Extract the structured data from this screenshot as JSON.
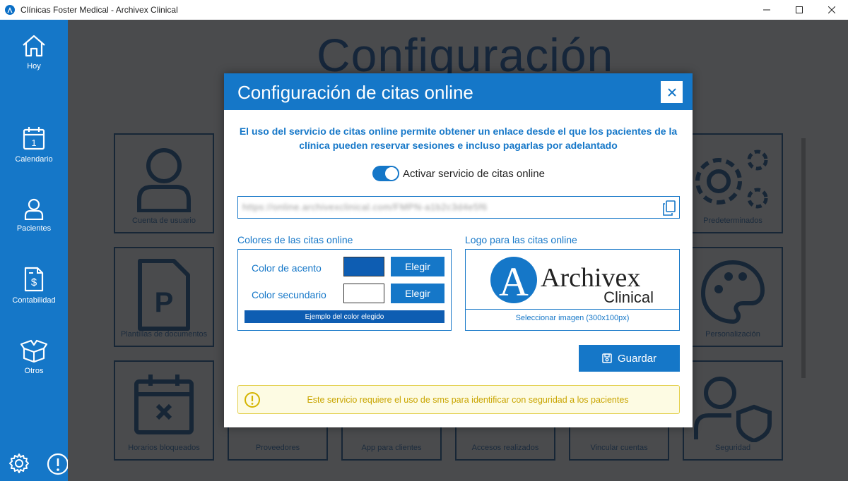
{
  "window": {
    "title": "Clínicas Foster Medical - Archivex Clinical"
  },
  "sidebar": {
    "items": [
      {
        "label": "Hoy",
        "icon": "home-icon"
      },
      {
        "label": "Calendario",
        "icon": "calendar-icon",
        "day": "1"
      },
      {
        "label": "Pacientes",
        "icon": "user-icon"
      },
      {
        "label": "Contabilidad",
        "icon": "invoice-icon"
      },
      {
        "label": "Otros",
        "icon": "gift-box-icon"
      }
    ],
    "bottom_icons": [
      "gear-icon",
      "alert-circle-icon"
    ]
  },
  "background": {
    "title": "Configuración",
    "tiles": [
      {
        "label": "Cuenta de usuario",
        "icon": "user-icon"
      },
      {
        "label": "Predeterminados",
        "icon": "gears-icon"
      },
      {
        "label": "Plantillas de documentos",
        "icon": "document-p-icon",
        "glyph": "P"
      },
      {
        "label": "Personalización",
        "icon": "palette-icon"
      },
      {
        "label": "Horarios bloqueados",
        "icon": "calendar-x-icon"
      },
      {
        "label": "Proveedores",
        "icon": "truck-icon"
      },
      {
        "label": "App para clientes",
        "icon": "phone-icon"
      },
      {
        "label": "Accesos realizados",
        "icon": "key-icon"
      },
      {
        "label": "Vincular cuentas",
        "icon": "link-icon"
      },
      {
        "label": "Seguridad",
        "icon": "user-shield-icon"
      }
    ]
  },
  "modal": {
    "title": "Configuración de citas online",
    "intro": "El uso del servicio de citas online permite obtener un enlace desde el que los pacientes de la clínica pueden reservar sesiones e incluso pagarlas por adelantado",
    "toggle": {
      "label": "Activar servicio de citas online",
      "on": true
    },
    "url": "https://online.archivexclinical.com/FMPN-a1b2c3d4e5f6",
    "colors": {
      "title": "Colores de las citas online",
      "accent_label": "Color de acento",
      "accent_value": "#0e5db2",
      "secondary_label": "Color secundario",
      "secondary_value": "#ffffff",
      "choose_label": "Elegir",
      "sample_label": "Ejemplo del color elegido"
    },
    "logo": {
      "title": "Logo para las citas online",
      "brand_main": "Archivex",
      "brand_sub": "Clinical",
      "brand_letter": "A",
      "select_label": "Seleccionar imagen (300x100px)"
    },
    "save_label": "Guardar",
    "warning": "Este servicio requiere el uso de sms para identificar con seguridad a los pacientes"
  },
  "colors": {
    "accent": "#1577c8",
    "sidebar": "#1577c8",
    "warning_border": "#e3cf4c",
    "warning_text": "#c9a500"
  }
}
